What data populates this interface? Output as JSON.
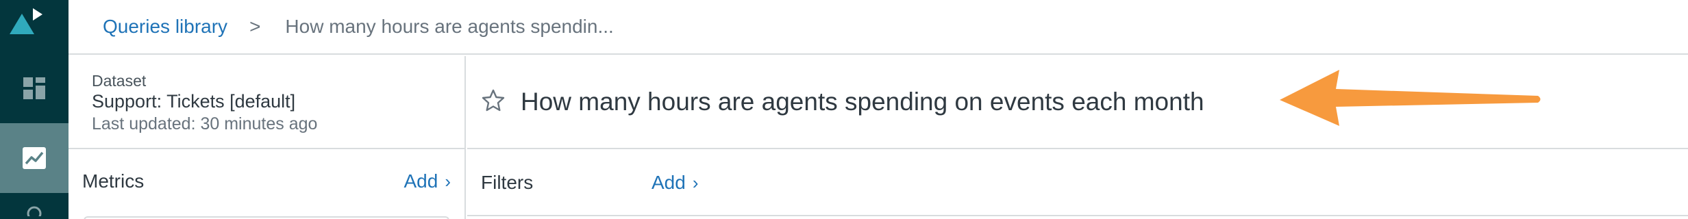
{
  "nav": {
    "items": [
      {
        "name": "dashboards",
        "icon": "dashboard-icon"
      },
      {
        "name": "queries",
        "icon": "trend-chart-icon",
        "active": true
      }
    ],
    "colors": {
      "rail": "#03363d",
      "active": "#5a8287",
      "logo": "#30aabc"
    }
  },
  "breadcrumb": {
    "parent": "Queries library",
    "separator": ">",
    "current": "How many hours are agents spendin..."
  },
  "dataset": {
    "label": "Dataset",
    "name": "Support: Tickets [default]",
    "updated": "Last updated: 30 minutes ago"
  },
  "query": {
    "title": "How many hours are agents spending on events each month",
    "star_icon": "star-icon",
    "favorited": false
  },
  "metrics": {
    "label": "Metrics",
    "add_label": "Add",
    "chevron": "›"
  },
  "filters": {
    "label": "Filters",
    "add_label": "Add",
    "chevron": "›"
  },
  "annotation": {
    "icon": "arrow-left-icon",
    "color": "#f79a3e"
  }
}
